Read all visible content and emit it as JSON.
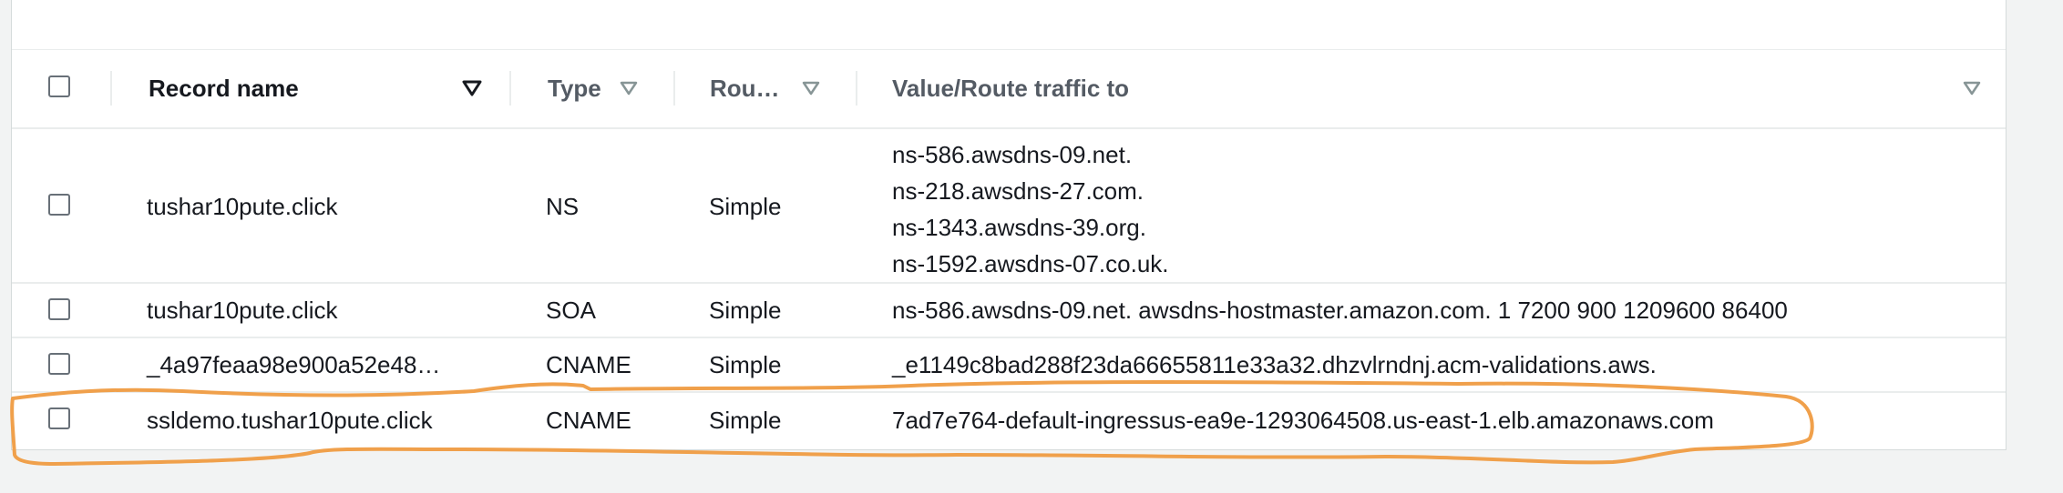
{
  "columns": {
    "record_name": "Record name",
    "type": "Type",
    "routing": "Rou…",
    "value": "Value/Route traffic to"
  },
  "icons": {
    "sort_active": "caret-down-filled-icon",
    "sort_inactive": "caret-down-outline-icon"
  },
  "rows": [
    {
      "name": "tushar10pute.click",
      "type": "NS",
      "routing": "Simple",
      "values": [
        "ns-586.awsdns-09.net.",
        "ns-218.awsdns-27.com.",
        "ns-1343.awsdns-39.org.",
        "ns-1592.awsdns-07.co.uk."
      ]
    },
    {
      "name": "tushar10pute.click",
      "type": "SOA",
      "routing": "Simple",
      "values": [
        "ns-586.awsdns-09.net. awsdns-hostmaster.amazon.com. 1 7200 900 1209600 86400"
      ]
    },
    {
      "name": "_4a97feaa98e900a52e48…",
      "type": "CNAME",
      "routing": "Simple",
      "values": [
        "_e1149c8bad288f23da66655811e33a32.dhzvlrndnj.acm-validations.aws."
      ]
    },
    {
      "name": "ssldemo.tushar10pute.click",
      "type": "CNAME",
      "routing": "Simple",
      "values": [
        "7ad7e764-default-ingressus-ea9e-1293064508.us-east-1.elb.amazonaws.com"
      ]
    }
  ],
  "colors": {
    "annotation_stroke": "#f0a04b",
    "border": "#eaeded",
    "header_text": "#16191f"
  }
}
